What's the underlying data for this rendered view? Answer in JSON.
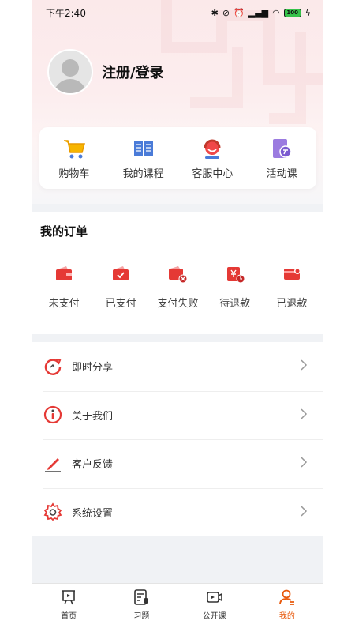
{
  "status_bar": {
    "time": "下午2:40",
    "battery": "100"
  },
  "profile": {
    "login_label": "注册/登录"
  },
  "quick_actions": [
    {
      "label": "购物车",
      "icon": "cart-icon"
    },
    {
      "label": "我的课程",
      "icon": "book-icon"
    },
    {
      "label": "客服中心",
      "icon": "headset-icon"
    },
    {
      "label": "活动课",
      "icon": "activity-course-icon"
    }
  ],
  "orders": {
    "title": "我的订单",
    "items": [
      {
        "label": "未支付",
        "icon": "unpaid-wallet-icon"
      },
      {
        "label": "已支付",
        "icon": "paid-wallet-icon"
      },
      {
        "label": "支付失败",
        "icon": "payment-failed-icon"
      },
      {
        "label": "待退款",
        "icon": "pending-refund-icon"
      },
      {
        "label": "已退款",
        "icon": "refunded-card-icon"
      }
    ]
  },
  "menu": [
    {
      "label": "即时分享",
      "icon": "share-icon"
    },
    {
      "label": "关于我们",
      "icon": "info-icon"
    },
    {
      "label": "客户反馈",
      "icon": "feedback-pen-icon"
    },
    {
      "label": "系统设置",
      "icon": "settings-gear-icon"
    }
  ],
  "bottom_nav": [
    {
      "label": "首页",
      "icon": "home-screen-icon"
    },
    {
      "label": "习题",
      "icon": "exercise-icon"
    },
    {
      "label": "公开课",
      "icon": "video-icon"
    },
    {
      "label": "我的",
      "icon": "profile-icon",
      "active": true
    }
  ],
  "colors": {
    "accent": "#e53935",
    "nav_active": "#e8590c",
    "background": "#f0f2f5"
  }
}
